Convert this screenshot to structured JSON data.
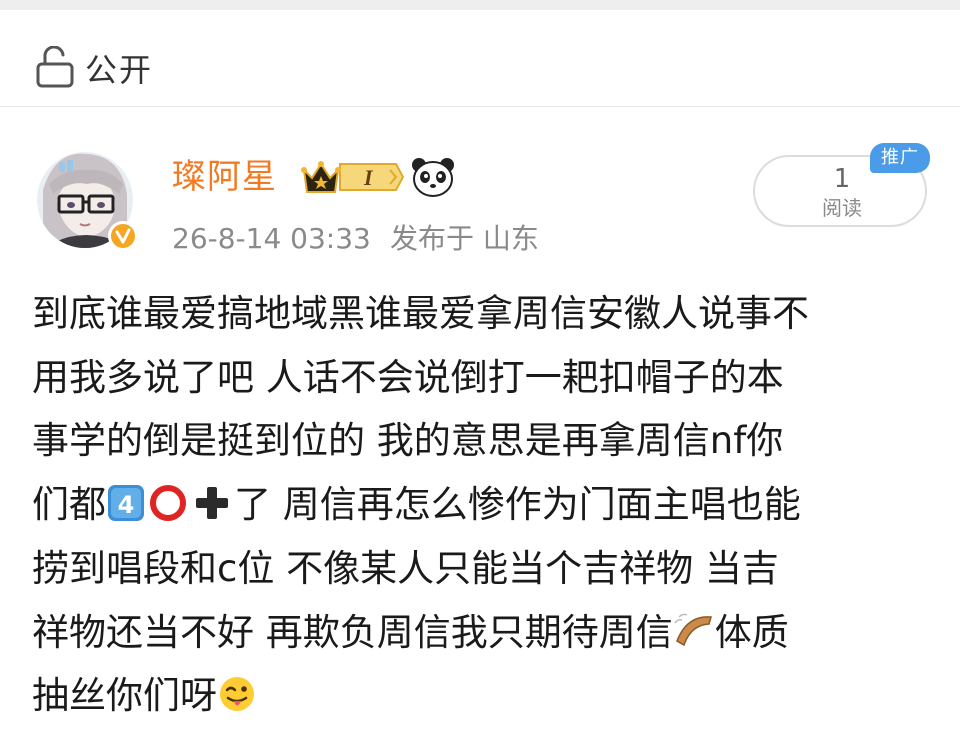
{
  "visibility": {
    "label": "公开",
    "icon": "lock-open-icon"
  },
  "author": {
    "name": "璨阿星",
    "vip_level": "I",
    "verified": true,
    "badges": [
      "crown-vip-badge",
      "panda-icon"
    ],
    "colors": {
      "name": "#f27a22",
      "verified": "#f5a623"
    }
  },
  "meta": {
    "time": "26-8-14 03:33",
    "location": "发布于 山东"
  },
  "reads": {
    "count": "1",
    "label": "阅读",
    "promo": "推广"
  },
  "post": {
    "lines": [
      "到底谁最爱搞地域黑谁最爱拿周信安徽人说事不",
      "用我多说了吧 人话不会说倒打一耙扣帽子的本",
      "事学的倒是挺到位的 我的意思是再拿周信nf你",
      "们都",
      "了 周信再怎么惨作为门面主唱也能",
      "捞到唱段和c位 不像某人只能当个吉祥物 当吉",
      "祥物还当不好 再欺负周信我只期待周信",
      "体质",
      "抽丝你们呀"
    ],
    "emojis": [
      "keycap-4-emoji",
      "hollow-red-circle-emoji",
      "plus-sign-emoji",
      "boomerang-emoji",
      "tongue-out-wink-emoji"
    ]
  }
}
